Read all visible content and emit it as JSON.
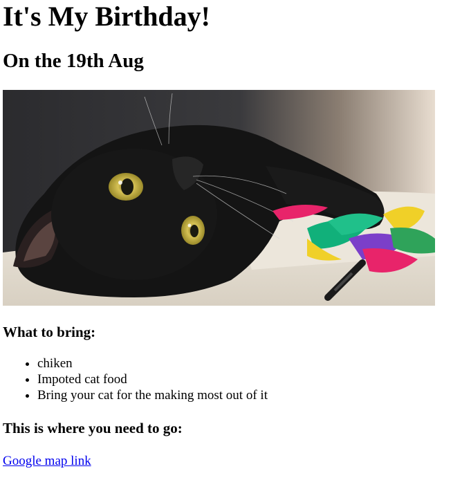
{
  "page": {
    "title": "It's My Birthday!",
    "date": "On the 19th Aug",
    "photo_alt": "cat-photo"
  },
  "bring": {
    "heading": "What to bring:",
    "items": [
      "chiken",
      "Impoted cat food",
      "Bring your cat for the making most out of it"
    ]
  },
  "location": {
    "heading": "This is where you need to go:",
    "link_text": "Google map link"
  },
  "colors": {
    "link": "#0000ee",
    "text": "#000000",
    "background": "#ffffff"
  }
}
